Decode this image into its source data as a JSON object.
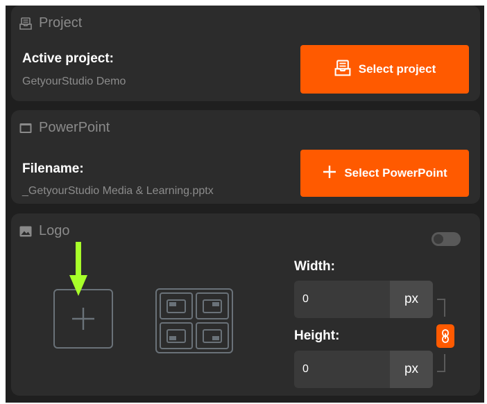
{
  "project": {
    "header": "Project",
    "active_label": "Active project:",
    "active_value": "GetyourStudio Demo",
    "select_button": "Select project"
  },
  "powerpoint": {
    "header": "PowerPoint",
    "filename_label": "Filename:",
    "filename_value": "_GetyourStudio Media & Learning.pptx",
    "select_button": "Select PowerPoint"
  },
  "logo": {
    "header": "Logo",
    "enabled": false,
    "width_label": "Width:",
    "width_value": "0",
    "width_unit": "px",
    "height_label": "Height:",
    "height_value": "0",
    "height_unit": "px"
  },
  "colors": {
    "accent": "#ff5a00",
    "annotation_arrow": "#a8ff2a",
    "panel": "#2c2c2c",
    "background": "#1f1f1f"
  },
  "icons": [
    "project-icon",
    "powerpoint-icon",
    "image-icon",
    "plus-icon",
    "position-grid-icon",
    "link-icon",
    "down-arrow-annotation"
  ]
}
